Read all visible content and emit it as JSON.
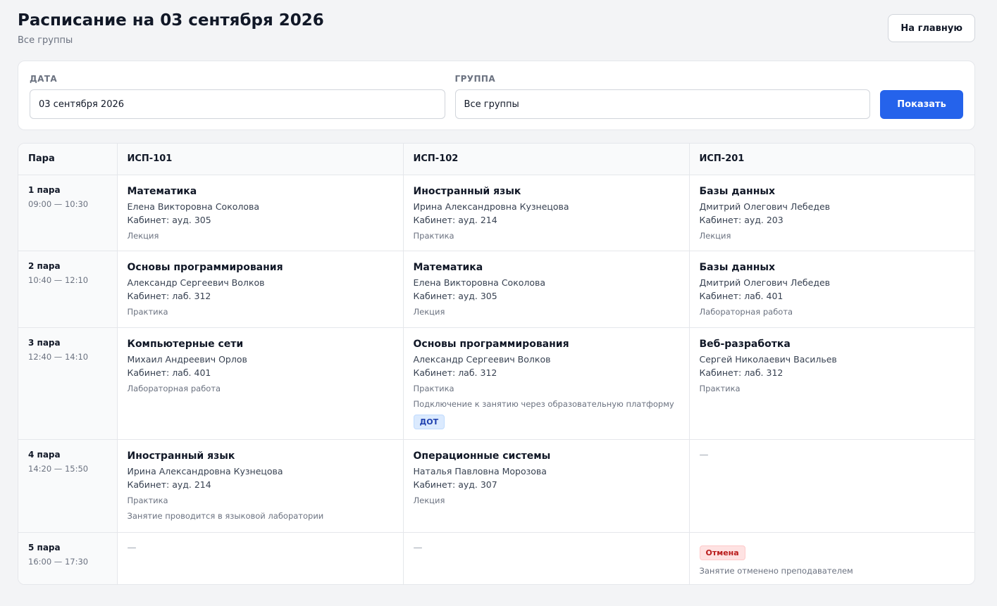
{
  "header": {
    "title": "Расписание на 03 сентября 2026",
    "subtitle": "Все группы",
    "home_button": "На главную"
  },
  "filters": {
    "date_label": "ДАТА",
    "date_value": "03 сентября 2026",
    "group_label": "ГРУППА",
    "group_value": "Все группы",
    "show_button": "Показать"
  },
  "table": {
    "columns": [
      "Пара",
      "ИСП-101",
      "ИСП-102",
      "ИСП-201"
    ],
    "rows": [
      {
        "pair": "1 пара",
        "time": "09:00 — 10:30",
        "cells": [
          {
            "subject": "Математика",
            "teacher": "Елена Викторовна Соколова",
            "room": "Кабинет: ауд. 305",
            "type": "Лекция"
          },
          {
            "subject": "Иностранный язык",
            "teacher": "Ирина Александровна Кузнецова",
            "room": "Кабинет: ауд. 214",
            "type": "Практика"
          },
          {
            "subject": "Базы данных",
            "teacher": "Дмитрий Олегович Лебедев",
            "room": "Кабинет: ауд. 203",
            "type": "Лекция"
          }
        ]
      },
      {
        "pair": "2 пара",
        "time": "10:40 — 12:10",
        "cells": [
          {
            "subject": "Основы программирования",
            "teacher": "Александр Сергеевич Волков",
            "room": "Кабинет: лаб. 312",
            "type": "Практика"
          },
          {
            "subject": "Математика",
            "teacher": "Елена Викторовна Соколова",
            "room": "Кабинет: ауд. 305",
            "type": "Лекция"
          },
          {
            "subject": "Базы данных",
            "teacher": "Дмитрий Олегович Лебедев",
            "room": "Кабинет: лаб. 401",
            "type": "Лабораторная работа"
          }
        ]
      },
      {
        "pair": "3 пара",
        "time": "12:40 — 14:10",
        "cells": [
          {
            "subject": "Компьютерные сети",
            "teacher": "Михаил Андреевич Орлов",
            "room": "Кабинет: лаб. 401",
            "type": "Лабораторная работа"
          },
          {
            "subject": "Основы программирования",
            "teacher": "Александр Сергеевич Волков",
            "room": "Кабинет: лаб. 312",
            "type": "Практика",
            "note": "Подключение к занятию через образовательную платформу",
            "badge": "ДОТ"
          },
          {
            "subject": "Веб-разработка",
            "teacher": "Сергей Николаевич Васильев",
            "room": "Кабинет: лаб. 312",
            "type": "Практика"
          }
        ]
      },
      {
        "pair": "4 пара",
        "time": "14:20 — 15:50",
        "cells": [
          {
            "subject": "Иностранный язык",
            "teacher": "Ирина Александровна Кузнецова",
            "room": "Кабинет: ауд. 214",
            "type": "Практика",
            "note": "Занятие проводится в языковой лаборатории"
          },
          {
            "subject": "Операционные системы",
            "teacher": "Наталья Павловна Морозова",
            "room": "Кабинет: ауд. 307",
            "type": "Лекция"
          },
          {
            "empty": "—"
          }
        ]
      },
      {
        "pair": "5 пара",
        "time": "16:00 — 17:30",
        "cells": [
          {
            "empty": "—"
          },
          {
            "empty": "—"
          },
          {
            "cancel_badge": "Отмена",
            "note": "Занятие отменено преподавателем"
          }
        ]
      }
    ]
  }
}
